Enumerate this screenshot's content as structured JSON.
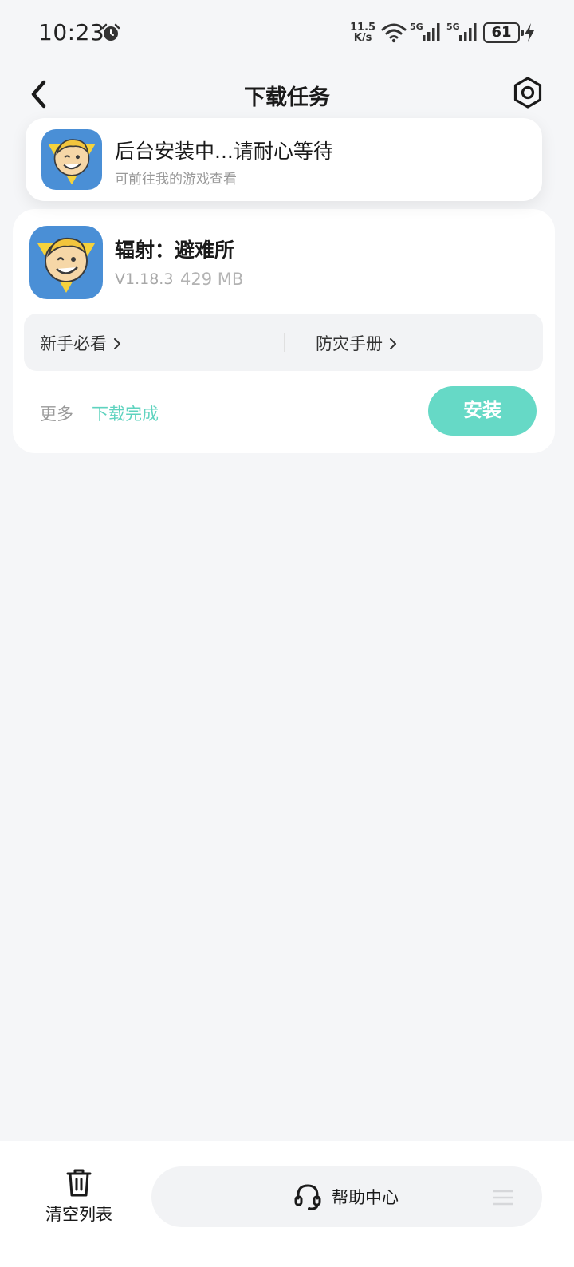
{
  "status_bar": {
    "time": "10:23",
    "net_speed_value": "11.5",
    "net_speed_unit": "K/s",
    "sim1_label": "5G",
    "sim2_label": "5G",
    "battery": "61"
  },
  "header": {
    "title": "下载任务",
    "back_icon": "chevron-left-icon",
    "settings_icon": "hexagon-gear-icon"
  },
  "toast": {
    "title": "后台安装中...请耐心等待",
    "subtitle": "可前往我的游戏查看"
  },
  "task": {
    "name": "辐射：避难所",
    "version": "V1.18.3",
    "size": "429 MB",
    "links": [
      "新手必看",
      "防灾手册"
    ],
    "more_label": "更多",
    "status": "下载完成",
    "install_label": "安装"
  },
  "bottom_bar": {
    "clear_label": "清空列表",
    "help_label": "帮助中心"
  },
  "colors": {
    "accent": "#66d9c6",
    "accent_text": "#5fd3bf",
    "background": "#f5f6f8"
  }
}
